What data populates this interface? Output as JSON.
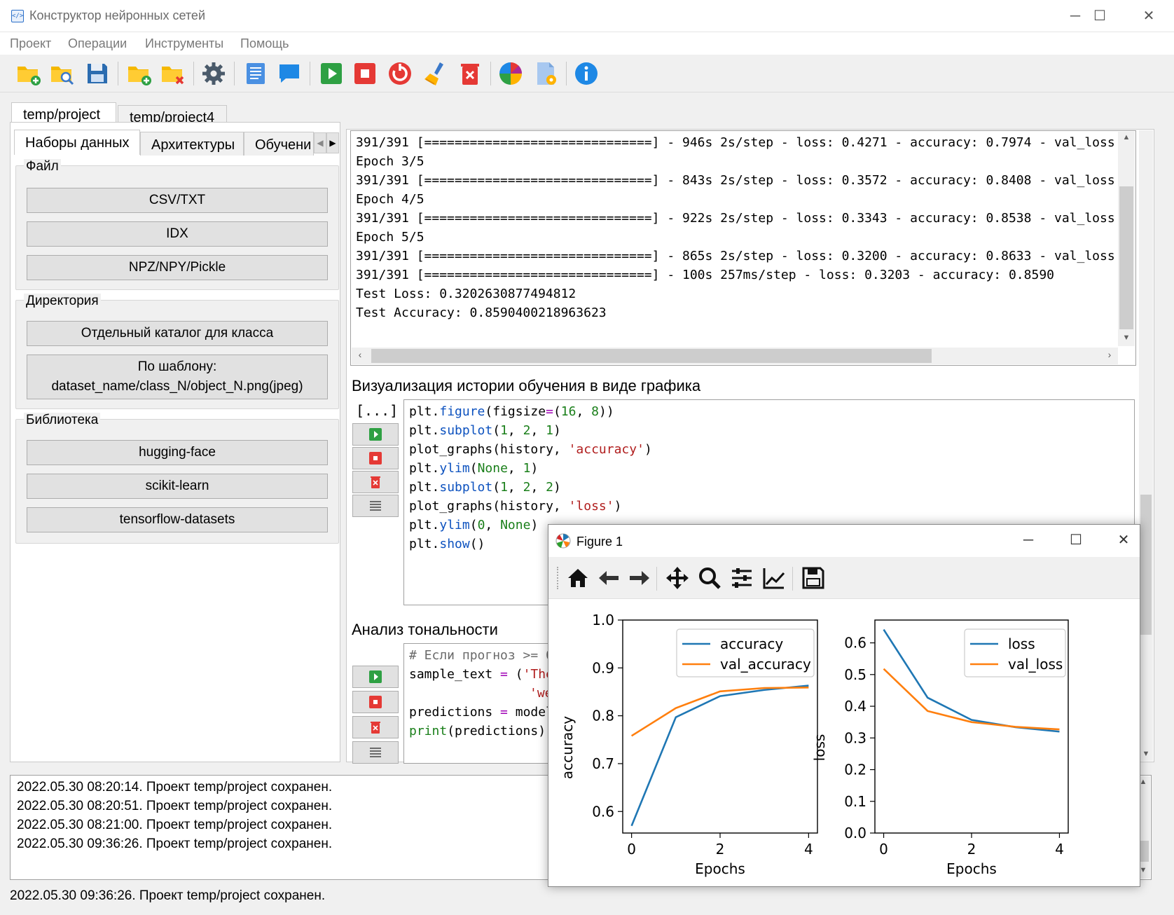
{
  "window": {
    "title": "Конструктор нейронных сетей",
    "icon_text": "</>"
  },
  "window_controls": {
    "minimize": "─",
    "maximize": "☐",
    "close": "✕"
  },
  "menu": [
    "Проект",
    "Операции",
    "Инструменты",
    "Помощь"
  ],
  "toolbar_icons": [
    "new-project-icon",
    "open-project-icon",
    "save-icon",
    "add-folder-icon",
    "delete-folder-icon",
    "settings-icon",
    "text-cell-icon",
    "comment-icon",
    "run-icon",
    "stop-icon",
    "restart-icon",
    "clear-icon",
    "delete-icon",
    "color-palette-icon",
    "file-settings-icon",
    "info-icon"
  ],
  "project_tabs": [
    "temp/project",
    "temp/project4"
  ],
  "sub_tabs": [
    "Наборы данных",
    "Архитектуры",
    "Обучени"
  ],
  "left": {
    "file_group": {
      "title": "Файл",
      "buttons": [
        "CSV/TXT",
        "IDX",
        "NPZ/NPY/Pickle"
      ]
    },
    "dir_group": {
      "title": "Директория",
      "buttons": [
        "Отдельный каталог для класса",
        "По шаблону:",
        "dataset_name/class_N/object_N.png(jpeg)"
      ]
    },
    "lib_group": {
      "title": "Библиотека",
      "buttons": [
        "hugging-face",
        "scikit-learn",
        "tensorflow-datasets"
      ]
    }
  },
  "console": [
    "391/391 [==============================] - 946s 2s/step - loss: 0.4271 - accuracy: 0.7974 - val_loss:",
    "Epoch 3/5",
    "391/391 [==============================] - 843s 2s/step - loss: 0.3572 - accuracy: 0.8408 - val_loss:",
    "Epoch 4/5",
    "391/391 [==============================] - 922s 2s/step - loss: 0.3343 - accuracy: 0.8538 - val_loss:",
    "Epoch 5/5",
    "391/391 [==============================] - 865s 2s/step - loss: 0.3200 - accuracy: 0.8633 - val_loss:",
    "391/391 [==============================] - 100s 257ms/step - loss: 0.3203 - accuracy: 0.8590",
    "Test Loss: 0.3202630877494812",
    "Test Accuracy: 0.8590400218963623"
  ],
  "cells": {
    "viz": {
      "title": "Визуализация истории обучения в виде графика",
      "prompt": "[...]",
      "code": {
        "l1": [
          "plt.",
          "figure",
          "(figsize",
          "=",
          "(",
          "16",
          ", ",
          "8",
          "))"
        ],
        "l2": [
          "plt.",
          "subplot",
          "(",
          "1",
          ", ",
          "2",
          ", ",
          "1",
          ")"
        ],
        "l3": [
          "plot_graphs(history, ",
          "'accuracy'",
          ")"
        ],
        "l4": [
          "plt.",
          "ylim",
          "(",
          "None",
          ", ",
          "1",
          ")"
        ],
        "l5": [
          "plt.",
          "subplot",
          "(",
          "1",
          ", ",
          "2",
          ", ",
          "2",
          ")"
        ],
        "l6": [
          "plot_graphs(history, ",
          "'loss'",
          ")"
        ],
        "l7": [
          "plt.",
          "ylim",
          "(",
          "0",
          ", ",
          "None",
          ")"
        ],
        "l8": [
          "plt.",
          "show",
          "()"
        ]
      }
    },
    "sentiment": {
      "title": "Анализ тональности",
      "code": {
        "l1": "# Если прогноз >= 0",
        "l2": [
          "sample_text ",
          "=",
          " (",
          "'The"
        ],
        "l3": "'we",
        "l4": [
          "predictions ",
          "=",
          " model"
        ],
        "l5": [
          "print",
          "(predictions)"
        ]
      }
    }
  },
  "log": [
    "2022.05.30 08:20:14. Проект temp/project сохранен.",
    "2022.05.30 08:20:51. Проект temp/project сохранен.",
    "2022.05.30 08:21:00. Проект temp/project сохранен.",
    "2022.05.30 09:36:26. Проект temp/project сохранен."
  ],
  "status": "2022.05.30 09:36:26. Проект temp/project сохранен.",
  "figure": {
    "title": "Figure 1",
    "toolbar_icons": [
      "home-icon",
      "back-arrow-icon",
      "forward-arrow-icon",
      "pan-icon",
      "zoom-icon",
      "configure-subplots-icon",
      "edit-axis-icon",
      "save-figure-icon"
    ]
  },
  "chart_data": [
    {
      "type": "line",
      "x": [
        0,
        1,
        2,
        3,
        4
      ],
      "series": [
        {
          "name": "accuracy",
          "values": [
            0.57,
            0.797,
            0.841,
            0.854,
            0.863
          ],
          "color": "#1f77b4"
        },
        {
          "name": "val_accuracy",
          "values": [
            0.758,
            0.816,
            0.851,
            0.858,
            0.859
          ],
          "color": "#ff7f0e"
        }
      ],
      "xlabel": "Epochs",
      "ylabel": "accuracy",
      "xlim": [
        -0.2,
        4.2
      ],
      "ylim": [
        0.555,
        1.0
      ],
      "xticks": [
        0,
        2,
        4
      ],
      "yticks": [
        0.6,
        0.7,
        0.8,
        0.9,
        1.0
      ],
      "ytick_labels": [
        "0.6",
        "0.7",
        "0.8",
        "0.9",
        "1.0"
      ],
      "legend": "top-right",
      "grid": false
    },
    {
      "type": "line",
      "x": [
        0,
        1,
        2,
        3,
        4
      ],
      "series": [
        {
          "name": "loss",
          "values": [
            0.642,
            0.427,
            0.357,
            0.334,
            0.32
          ],
          "color": "#1f77b4"
        },
        {
          "name": "val_loss",
          "values": [
            0.518,
            0.385,
            0.35,
            0.335,
            0.327
          ],
          "color": "#ff7f0e"
        }
      ],
      "xlabel": "Epochs",
      "ylabel": "loss",
      "xlim": [
        -0.2,
        4.2
      ],
      "ylim": [
        0.0,
        0.672
      ],
      "xticks": [
        0,
        2,
        4
      ],
      "yticks": [
        0.0,
        0.1,
        0.2,
        0.3,
        0.4,
        0.5,
        0.6
      ],
      "ytick_labels": [
        "0.0",
        "0.1",
        "0.2",
        "0.3",
        "0.4",
        "0.5",
        "0.6"
      ],
      "legend": "top-right",
      "grid": false
    }
  ]
}
